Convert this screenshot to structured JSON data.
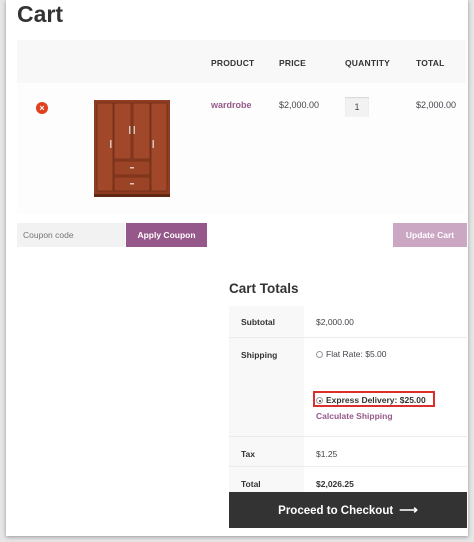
{
  "page": {
    "title": "Cart"
  },
  "cart_table": {
    "headers": {
      "product": "PRODUCT",
      "price": "PRICE",
      "quantity": "QUANTITY",
      "total": "TOTAL"
    },
    "rows": [
      {
        "product": "wardrobe",
        "price": "$2,000.00",
        "quantity": "1",
        "total": "$2,000.00",
        "remove_icon": "remove-x-icon",
        "thumbnail": "wardrobe-thumbnail"
      }
    ]
  },
  "actions": {
    "coupon_placeholder": "Coupon code",
    "apply_label": "Apply Coupon",
    "update_label": "Update Cart"
  },
  "totals": {
    "title": "Cart Totals",
    "subtotal_label": "Subtotal",
    "subtotal_value": "$2,000.00",
    "shipping_label": "Shipping",
    "shipping_options": [
      {
        "label": "Flat Rate:",
        "price": "$5.00",
        "selected": false
      },
      {
        "label": "Express Delivery:",
        "price": "$25.00",
        "selected": true
      }
    ],
    "calculate_label": "Calculate Shipping",
    "tax_label": "Tax",
    "tax_value": "$1.25",
    "total_label": "Total",
    "total_value": "$2,026.25"
  },
  "checkout": {
    "label": "Proceed to Checkout",
    "arrow": "⟶"
  },
  "colors": {
    "accent": "#96588a",
    "accent_light": "#cba7c4",
    "remove": "#e2401c",
    "highlight": "#d9302d",
    "dark_button": "#333333"
  }
}
